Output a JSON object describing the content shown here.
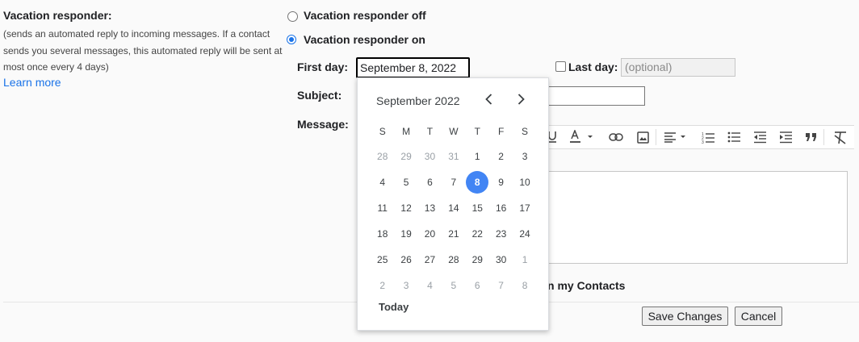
{
  "left": {
    "title": "Vacation responder:",
    "description": "(sends an automated reply to incoming messages. If a contact sends you several messages, this automated reply will be sent at most once every 4 days)",
    "learn_more": "Learn more"
  },
  "responder": {
    "off_label": "Vacation responder off",
    "on_label": "Vacation responder on",
    "selected": "on"
  },
  "first_day": {
    "label": "First day:",
    "value": "September 8, 2022"
  },
  "last_day": {
    "label": "Last day:",
    "placeholder": "(optional)",
    "checked": false
  },
  "subject": {
    "label": "Subject:"
  },
  "message": {
    "label": "Message:"
  },
  "contacts_text": "n my Contacts",
  "buttons": {
    "save": "Save Changes",
    "cancel": "Cancel"
  },
  "calendar": {
    "month_label": "September 2022",
    "weekdays": [
      "S",
      "M",
      "T",
      "W",
      "T",
      "F",
      "S"
    ],
    "weeks": [
      [
        "28",
        "29",
        "30",
        "31",
        "1",
        "2",
        "3"
      ],
      [
        "4",
        "5",
        "6",
        "7",
        "8",
        "9",
        "10"
      ],
      [
        "11",
        "12",
        "13",
        "14",
        "15",
        "16",
        "17"
      ],
      [
        "18",
        "19",
        "20",
        "21",
        "22",
        "23",
        "24"
      ],
      [
        "25",
        "26",
        "27",
        "28",
        "29",
        "30",
        "1"
      ],
      [
        "2",
        "3",
        "4",
        "5",
        "6",
        "7",
        "8"
      ]
    ],
    "selected_day": "8",
    "today_label": "Today"
  },
  "toolbar_icons": [
    "underline-icon",
    "text-color-icon",
    "link-icon",
    "image-icon",
    "align-icon",
    "numbered-list-icon",
    "bulleted-list-icon",
    "indent-less-icon",
    "indent-more-icon",
    "quote-icon",
    "remove-formatting-icon"
  ],
  "colors": {
    "accent": "#1a73e8",
    "selected_day": "#4285f4"
  }
}
